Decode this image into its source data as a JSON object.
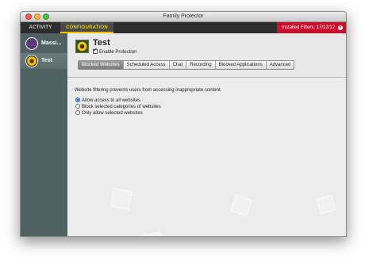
{
  "window": {
    "title": "Family Protector"
  },
  "tabs": {
    "activity": "ACTIVITY",
    "configuration": "CONFIGURATION"
  },
  "filters": {
    "label": "Installed Filters: 17/12/12"
  },
  "sidebar": {
    "users": [
      {
        "name": "Massi..."
      },
      {
        "name": "Test"
      }
    ]
  },
  "profile": {
    "name": "Test",
    "enable_label": "Enable Protection"
  },
  "segments": [
    "Blocked Websites",
    "Scheduled Access",
    "Chat",
    "Recording",
    "Blocked Applications",
    "Advanced"
  ],
  "web_filter": {
    "description": "Website filtering prevents users from accessing inappropriate content.",
    "options": [
      "Allow access to all websites",
      "Block selected categories of websites",
      "Only allow selected websites"
    ]
  },
  "colors": {
    "accent": "#f2c500",
    "filters_bg": "#c8102e",
    "sidebar_bg": "#4f6161"
  },
  "icons": {
    "close": "close-icon",
    "avatar": "avatar-icon"
  }
}
